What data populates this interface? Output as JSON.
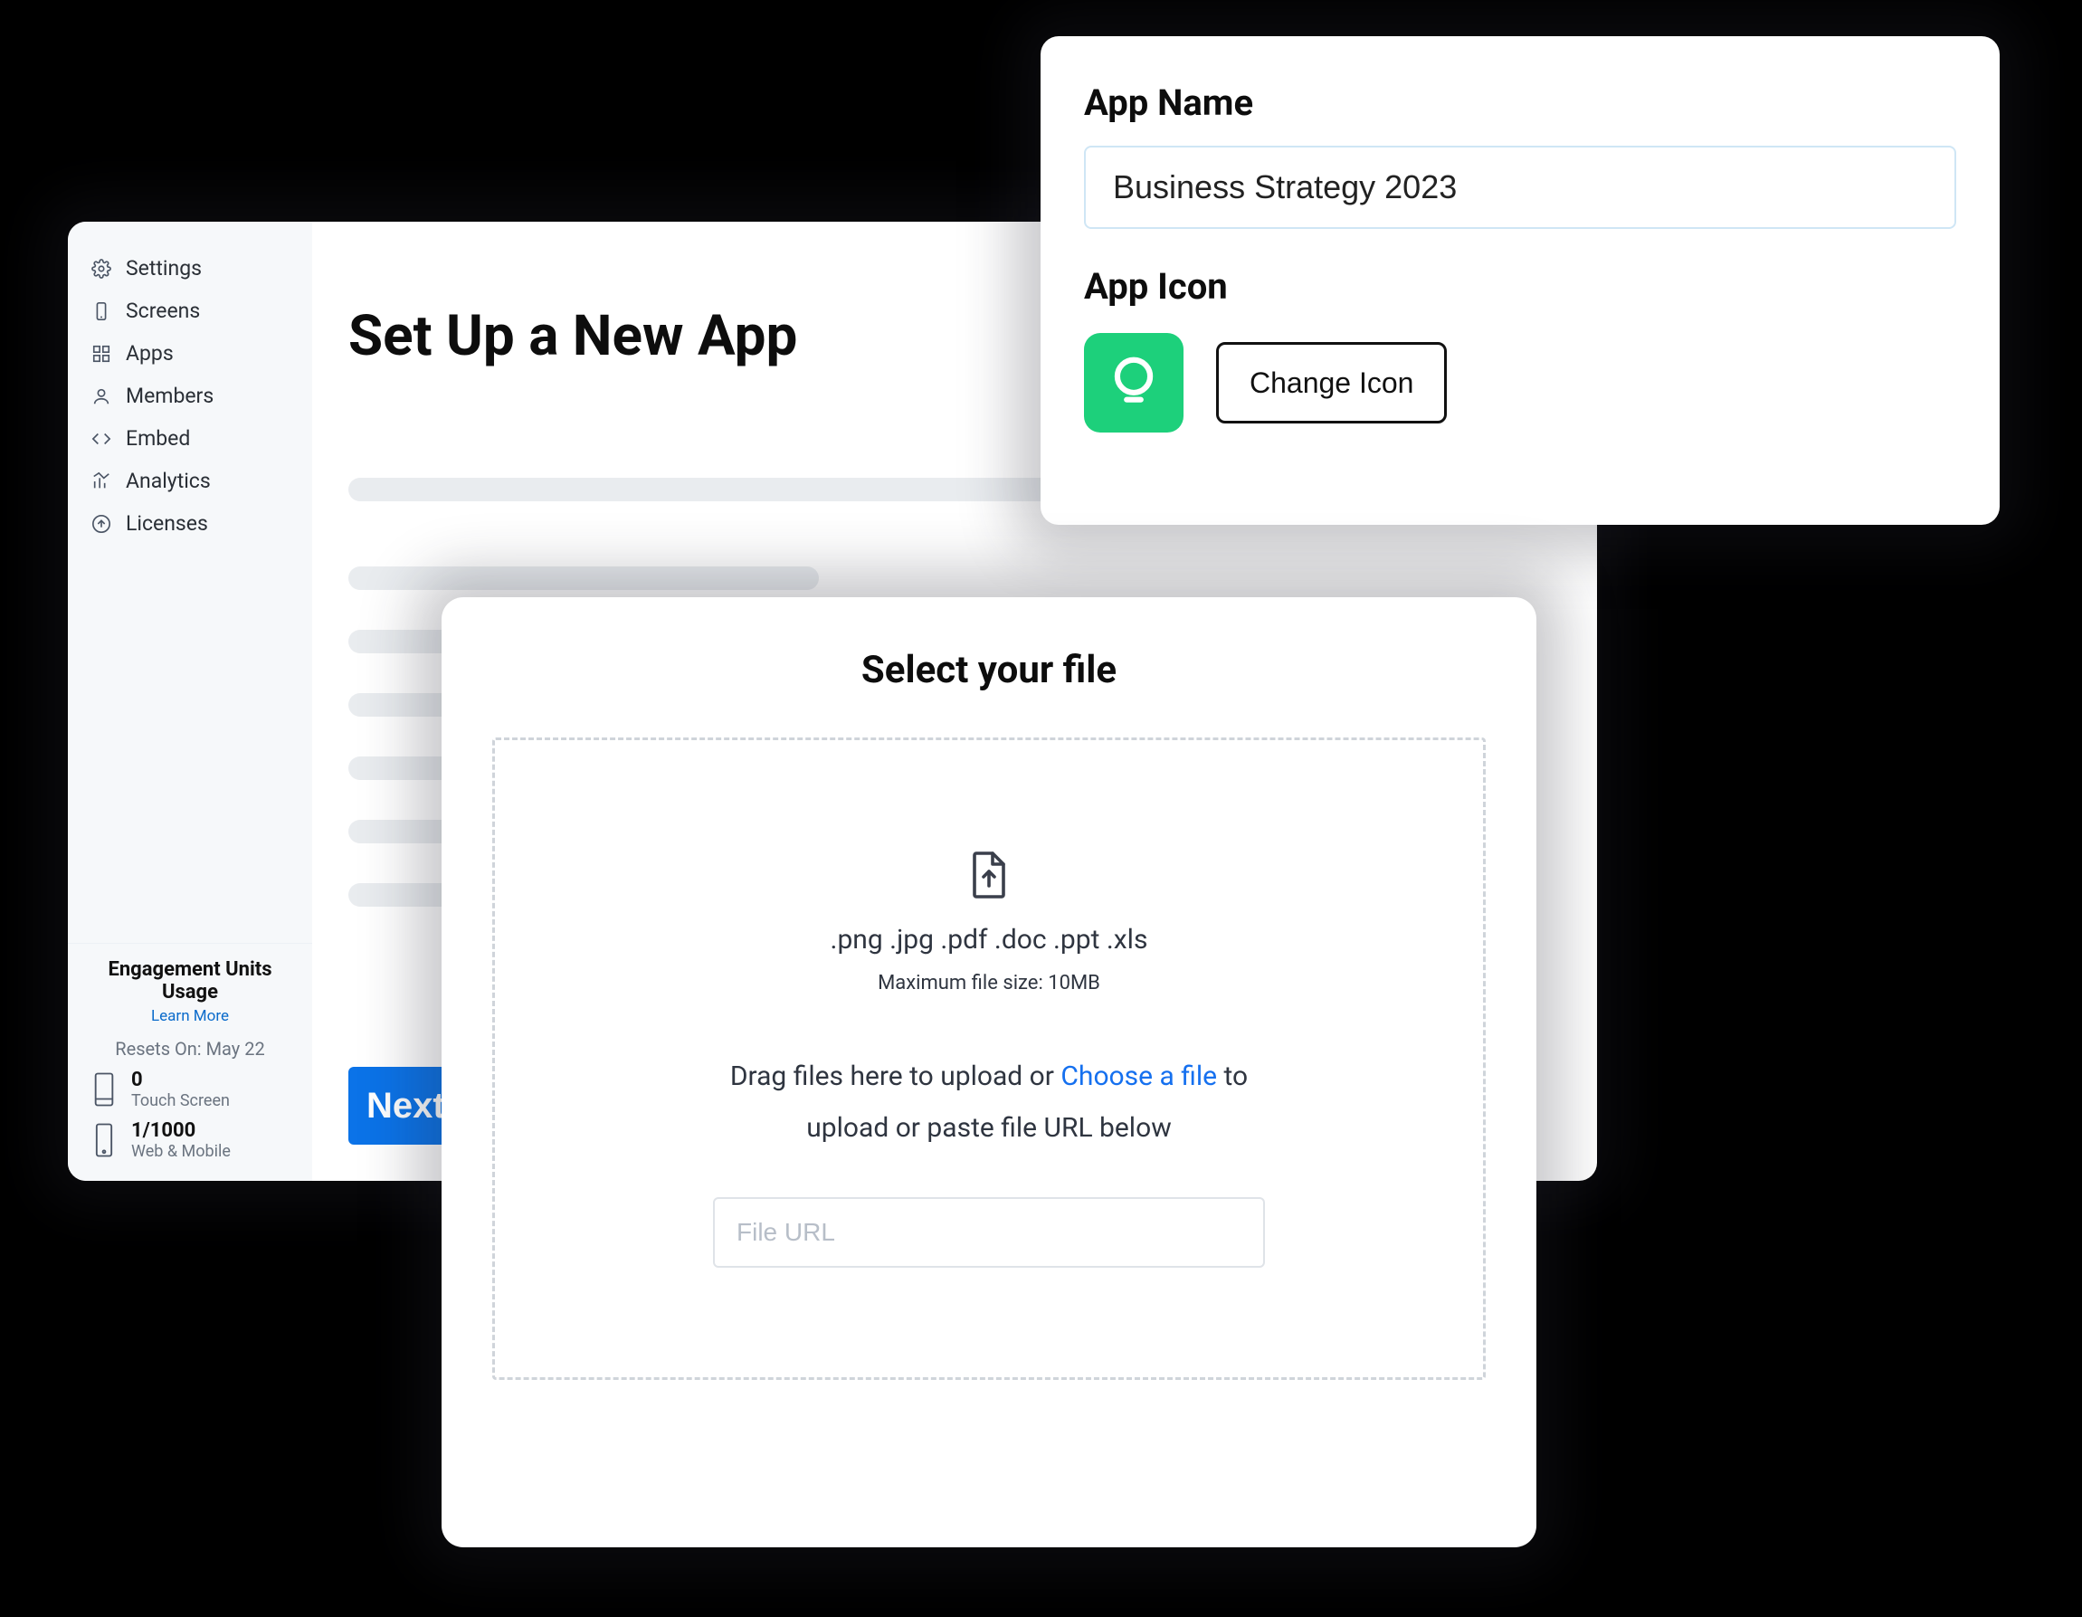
{
  "sidebar": {
    "items": [
      {
        "label": "Settings"
      },
      {
        "label": "Screens"
      },
      {
        "label": "Apps"
      },
      {
        "label": "Members"
      },
      {
        "label": "Embed"
      },
      {
        "label": "Analytics"
      },
      {
        "label": "Licenses"
      }
    ],
    "usage": {
      "title": "Engagement Units Usage",
      "learn_more": "Learn More",
      "reset_label": "Resets On: May 22",
      "touch_count": "0",
      "touch_label": "Touch Screen",
      "web_count": "1/1000",
      "web_label": "Web & Mobile"
    }
  },
  "main": {
    "title": "Set Up a New App",
    "next_label": "Next"
  },
  "app_panel": {
    "name_label": "App Name",
    "name_value": "Business Strategy 2023",
    "icon_label": "App Icon",
    "change_icon_label": "Change Icon"
  },
  "file_panel": {
    "title": "Select your file",
    "extensions": ".png   .jpg   .pdf   .doc   .ppt   .xls",
    "max_size": "Maximum file size: 10MB",
    "drag_prefix": "Drag files here to upload or ",
    "choose": "Choose a file",
    "drag_suffix": " to upload or paste file URL below",
    "url_placeholder": "File URL"
  }
}
